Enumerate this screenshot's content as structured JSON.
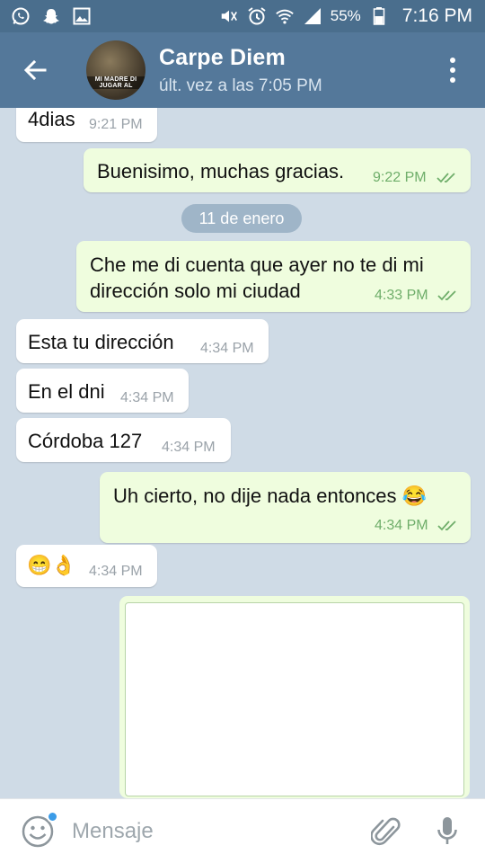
{
  "status_bar": {
    "battery": "55%",
    "time": "7:16 PM",
    "left_icons": [
      "whatsapp-icon",
      "snapchat-icon",
      "gallery-icon"
    ],
    "right_icons": [
      "mute-icon",
      "alarm-icon",
      "wifi-icon",
      "signal-icon",
      "battery-icon"
    ]
  },
  "header": {
    "name": "Carpe Diem",
    "status": "últ. vez a las 7:05 PM",
    "avatar_text": "MI MADRE DI JUGAR AL"
  },
  "messages": [
    {
      "dir": "in",
      "text": "4dias",
      "time": "9:21 PM"
    },
    {
      "dir": "out",
      "text": "Buenisimo, muchas gracias.",
      "time": "9:22 PM",
      "read": true
    },
    {
      "dir": "out",
      "text_lines": [
        "Che me di cuenta que ayer no te di mi",
        "dirección solo mi ciudad"
      ],
      "time": "4:33 PM",
      "read": true
    },
    {
      "dir": "in",
      "text": "Esta tu dirección",
      "time": "4:34 PM"
    },
    {
      "dir": "in",
      "text": "En el dni",
      "time": "4:34 PM"
    },
    {
      "dir": "in",
      "text": "Córdoba 127",
      "time": "4:34 PM"
    },
    {
      "dir": "out",
      "text": "Uh cierto, no dije nada entonces",
      "emoji": "😂",
      "time": "4:34 PM",
      "read": true
    },
    {
      "dir": "in",
      "emoji": "😁👌",
      "time": "4:34 PM"
    }
  ],
  "date_separator": "11 de enero",
  "input": {
    "placeholder": "Mensaje"
  },
  "colors": {
    "status_bar": "#4a6e8d",
    "app_bar": "#54789a",
    "chat_bg": "#cfdbe6",
    "outgoing": "#effdde",
    "incoming": "#ffffff",
    "check": "#6fae6a"
  }
}
